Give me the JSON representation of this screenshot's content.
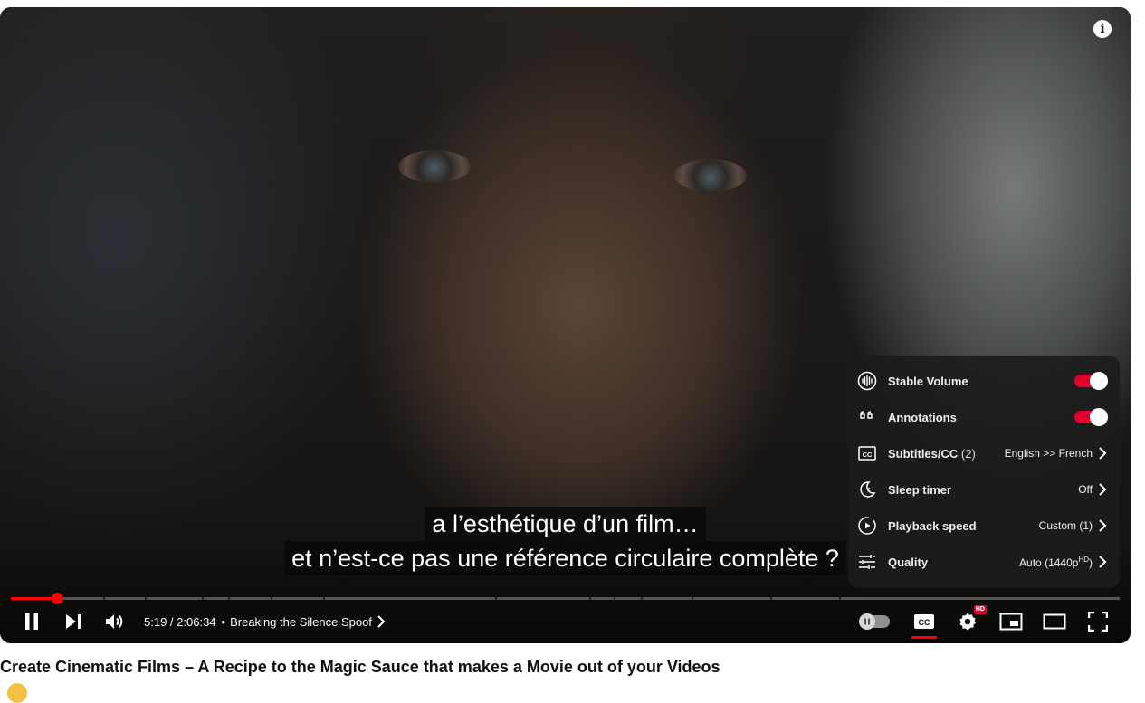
{
  "colors": {
    "accent": "#ff0000",
    "toggle_on": "#e1002d",
    "menu_bg": "#1c1c1c"
  },
  "captions": {
    "line1": "a l’esthétique d’un film…",
    "line2": "et n’est-ce pas une référence circulaire complète ?"
  },
  "settings_menu": {
    "stable_volume": {
      "label": "Stable Volume",
      "on": true,
      "icon": "stable-volume-icon"
    },
    "annotations": {
      "label": "Annotations",
      "on": true,
      "icon": "quote-icon"
    },
    "subtitles": {
      "label": "Subtitles/CC",
      "count": "(2)",
      "value": "English >> French",
      "icon": "cc-icon"
    },
    "sleep_timer": {
      "label": "Sleep timer",
      "value": "Off",
      "icon": "moon-icon"
    },
    "playback_speed": {
      "label": "Playback speed",
      "value": "Custom (1)",
      "icon": "playback-speed-icon"
    },
    "quality": {
      "label": "Quality",
      "value": "Auto (1440p",
      "value_badge": "HD",
      "value_close": ")",
      "icon": "sliders-icon"
    }
  },
  "player": {
    "current_time": "5:19",
    "separator": " / ",
    "duration": "2:06:34",
    "chapter_bullet": "•",
    "chapter": "Breaking the Silence Spoof",
    "progress_fraction": 0.042,
    "hd_badge": "HD"
  },
  "video": {
    "title": "Create Cinematic Films – A Recipe to the Magic Sauce that makes a Movie out of your Videos"
  }
}
